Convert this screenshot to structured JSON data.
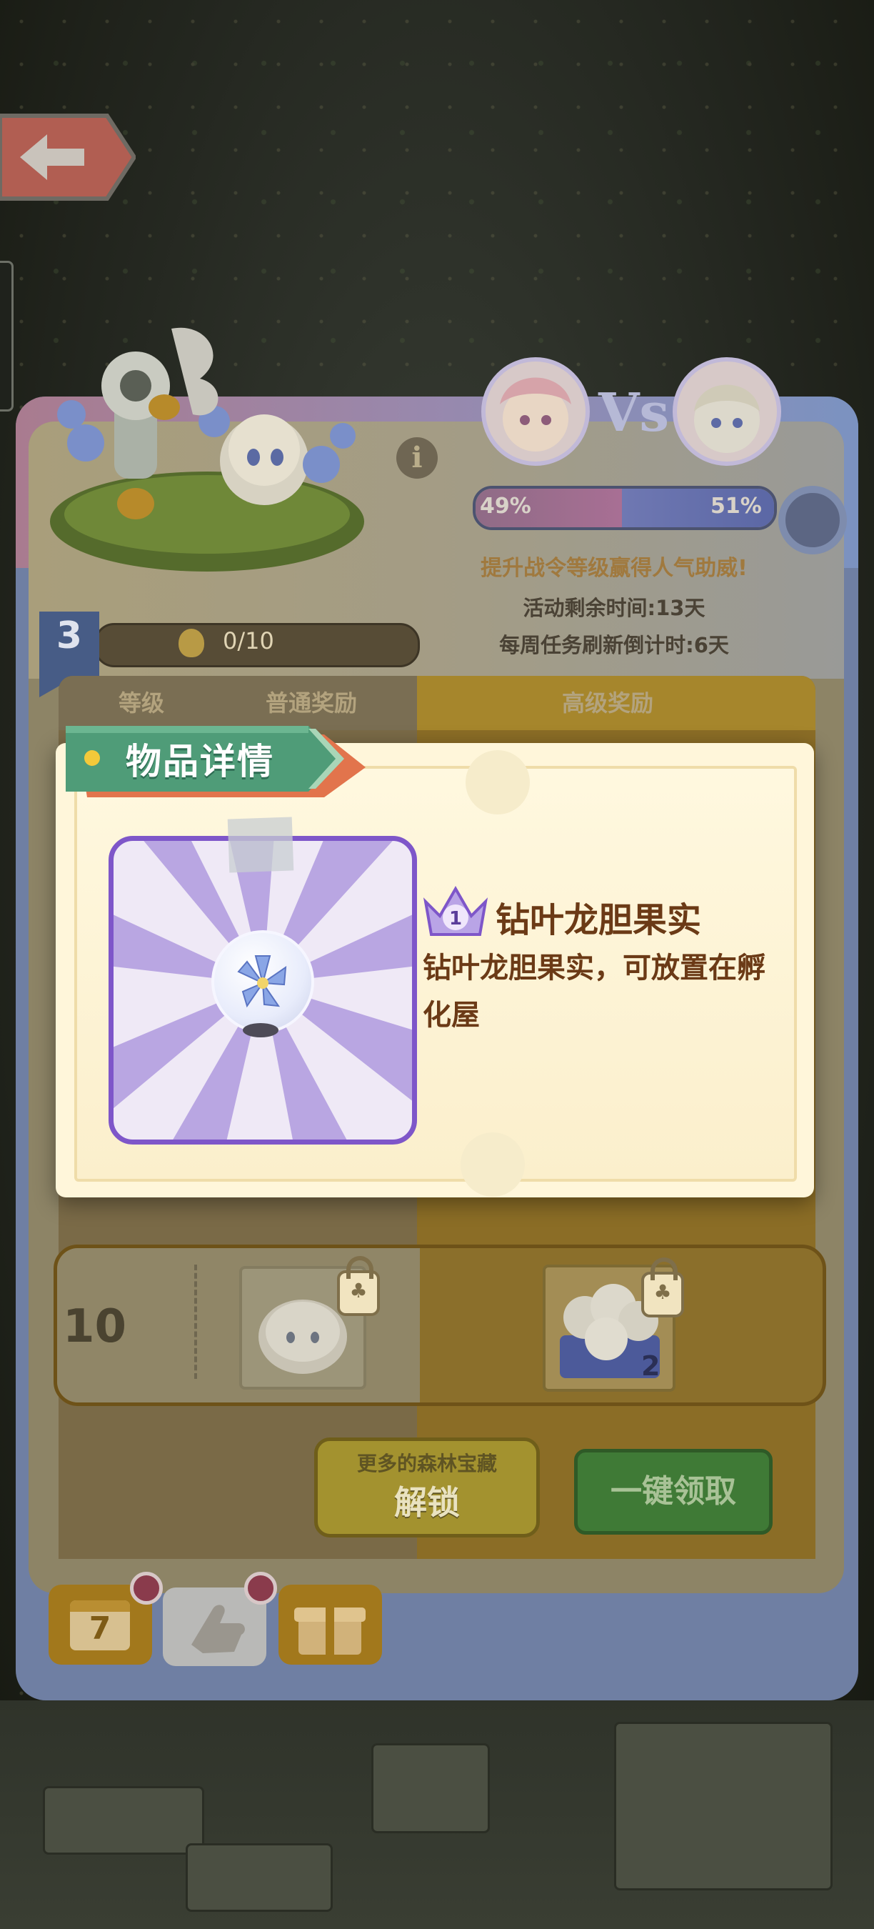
{
  "vote": {
    "left_percent": "49%",
    "right_percent": "51%",
    "left_fraction": 0.49
  },
  "info": {
    "promo": "提升战令等级赢得人气助威!",
    "time_remaining": "活动剩余时间:13天",
    "weekly_refresh": "每周任务刷新倒计时:6天"
  },
  "level": {
    "current": "3",
    "progress": "0/10"
  },
  "table_header": {
    "level": "等级",
    "normal_reward": "普通奖励",
    "premium_reward": "高级奖励"
  },
  "reward_row": {
    "level": "10",
    "premium_count": "2"
  },
  "buttons": {
    "unlock_small": "更多的森林宝藏",
    "unlock_big": "解锁",
    "claim_all": "一键领取"
  },
  "bottom_tabs": {
    "calendar_number": "7"
  },
  "modal": {
    "title": "物品详情",
    "item_level": "1",
    "item_name": "钻叶龙胆果实",
    "item_description": "钻叶龙胆果实，可放置在孵化屋"
  },
  "colors": {
    "item_frame": "#7e56c9",
    "ribbon_green": "#4f9c78",
    "ribbon_orange": "#e2744c",
    "item_text": "#6b3a16"
  },
  "icons": [
    "back-arrow-icon",
    "info-icon",
    "crown-level-icon",
    "lock-icon",
    "calendar-icon",
    "hand-icon",
    "gift-icon",
    "flower-icon",
    "egg-icon"
  ]
}
